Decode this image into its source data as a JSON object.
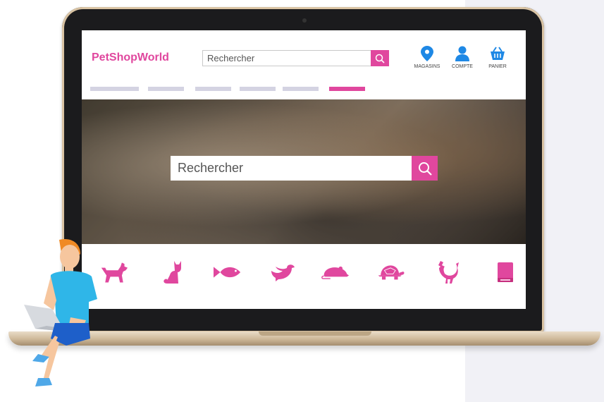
{
  "brand": {
    "name": "PetShopWorld",
    "accent": "#e0479e"
  },
  "header": {
    "search": {
      "placeholder": "Rechercher",
      "button_icon": "search-icon"
    },
    "nav": [
      {
        "label": "MAGASINS",
        "icon": "location-pin-icon",
        "color": "#1e88e5"
      },
      {
        "label": "COMPTE",
        "icon": "user-icon",
        "color": "#1e88e5"
      },
      {
        "label": "PANIER",
        "icon": "basket-icon",
        "color": "#1e88e5"
      }
    ],
    "menu_tabs": [
      {
        "active": false
      },
      {
        "active": false
      },
      {
        "active": false
      },
      {
        "active": false
      },
      {
        "active": false
      },
      {
        "active": true
      }
    ]
  },
  "hero": {
    "image": "cat-and-dog-photo",
    "search": {
      "placeholder": "Rechercher",
      "button_icon": "search-icon"
    }
  },
  "categories": [
    {
      "icon": "dog-icon"
    },
    {
      "icon": "cat-icon"
    },
    {
      "icon": "fish-icon"
    },
    {
      "icon": "bird-icon"
    },
    {
      "icon": "rodent-icon"
    },
    {
      "icon": "turtle-icon"
    },
    {
      "icon": "poultry-icon"
    },
    {
      "icon": "book-icon"
    }
  ]
}
